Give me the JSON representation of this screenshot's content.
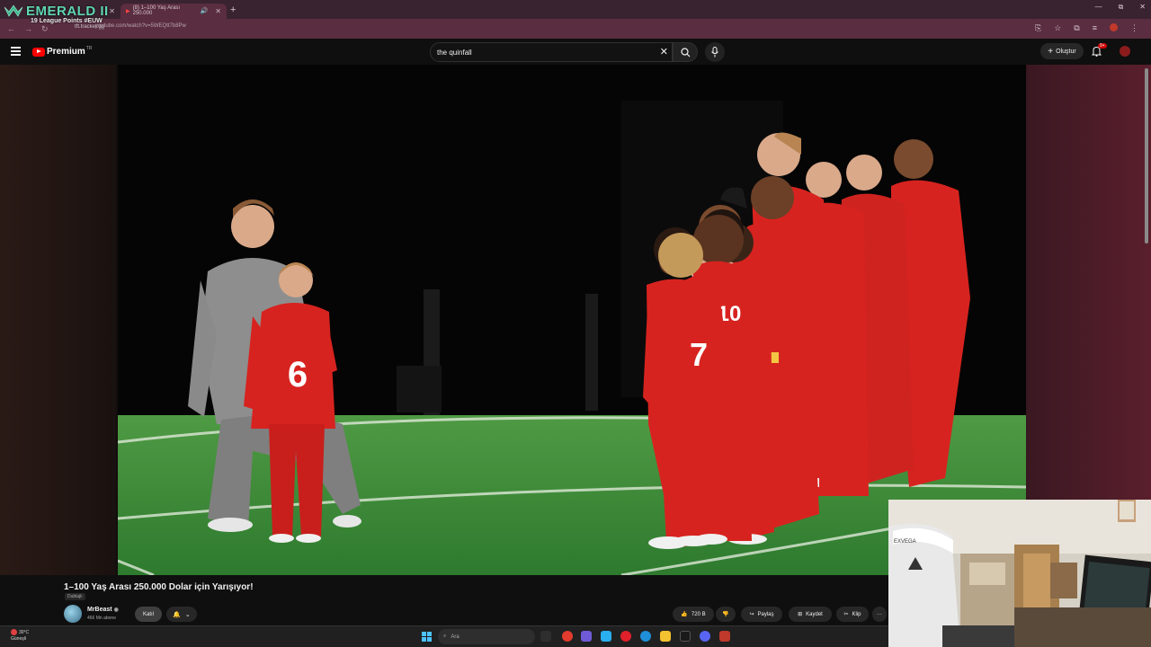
{
  "browser": {
    "tabs": [
      {
        "label": ""
      },
      {
        "label": "(8) 1–100 Yaş Arası 250.000"
      }
    ],
    "new_tab": "+",
    "url": "youtube.com/watch?v=5WEQtt7b8Pw",
    "window_controls": [
      "—",
      "⧉",
      "✕"
    ]
  },
  "rank_overlay": {
    "title": "EMERALD II",
    "subtitle": "19 League Points #EUW",
    "tracker": "tft.tracker.gg"
  },
  "youtube": {
    "logo_text": "Premium",
    "logo_region": "TR",
    "search_value": "the quinfall",
    "create_label": "Oluştur",
    "notif_count": "9+"
  },
  "video": {
    "title": "1–100 Yaş Arası 250.000 Dolar için Yarışıyor!",
    "dub_label": "Dublajlı",
    "channel": "MrBeast",
    "verified": "◉",
    "subscribers": "466 Mn abone",
    "join_label": "Katıl",
    "likes": "720 B",
    "share_label": "Paylaş",
    "save_label": "Kaydet",
    "clip_label": "Klip",
    "more_label": "···",
    "jersey_numbers": [
      "6",
      "7",
      "10"
    ],
    "webcam_brand": "EXVEGA"
  },
  "taskbar": {
    "weather_temp": "30°C",
    "weather_desc": "Güneşli",
    "search_placeholder": "Ara"
  },
  "colors": {
    "browser_frame": "#3a2330",
    "browser_toolbar": "#5a2d40",
    "youtube_red": "#ff0000",
    "jersey_red": "#d7231f",
    "pitch_green": "#3d8a3a",
    "emerald": "#5fd6b0"
  }
}
